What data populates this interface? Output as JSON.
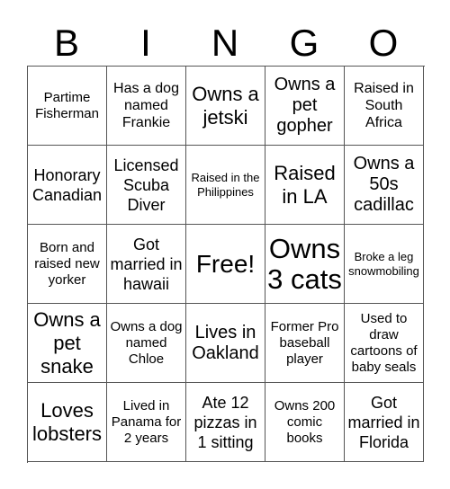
{
  "header": [
    "B",
    "I",
    "N",
    "G",
    "O"
  ],
  "cells": [
    "Partime Fisherman",
    "Has a dog named Frankie",
    "Owns a jetski",
    "Owns a pet gopher",
    "Raised in South Africa",
    "Honorary Canadian",
    "Licensed Scuba Diver",
    "Raised in the Philippines",
    "Raised in LA",
    "Owns a 50s cadillac",
    "Born and raised new yorker",
    "Got married in hawaii",
    "Free!",
    "Owns 3 cats",
    "Broke a leg snowmobiling",
    "Owns a pet snake",
    "Owns a dog named Chloe",
    "Lives in Oakland",
    "Former Pro baseball player",
    "Used to draw cartoons of baby seals",
    "Loves lobsters",
    "Lived in Panama for 2 years",
    "Ate 12 pizzas in 1 sitting",
    "Owns 200 comic books",
    "Got married in Florida"
  ]
}
